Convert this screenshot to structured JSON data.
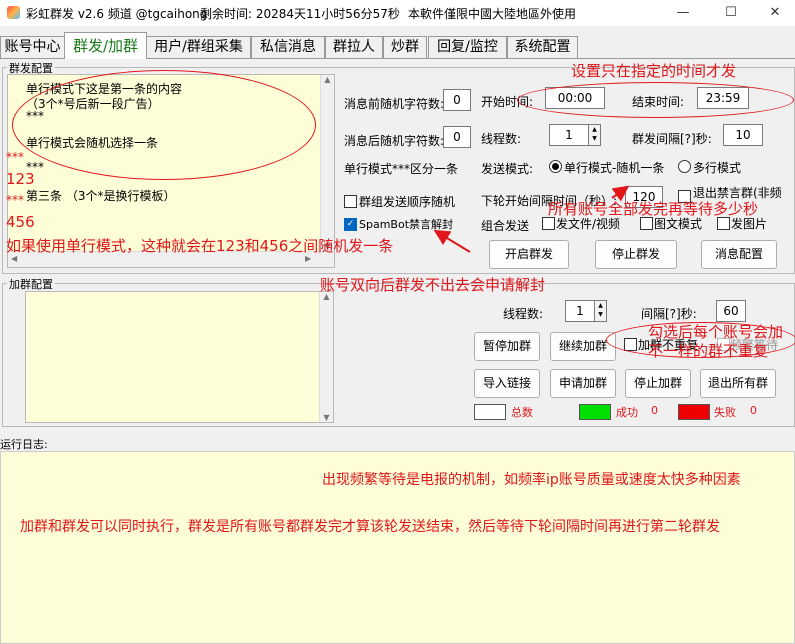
{
  "titlebar": {
    "app_name": "彩虹群发 v2.6 频道 @tgcaihong",
    "remaining": "剩余时间: 20284天11小时56分57秒",
    "notice": "本軟件僅限中國大陸地區外使用",
    "min_label": "—",
    "max_label": "☐",
    "close_label": "✕"
  },
  "tabs": [
    "账号中心",
    "群发/加群",
    "用户/群组采集",
    "私信消息",
    "群拉人",
    "炒群",
    "回复/监控",
    "系统配置"
  ],
  "broadcast": {
    "group_label": "群发配置",
    "message_lines": [
      "单行模式下这是第一条的内容",
      "（3个*号后新一段广告）",
      "***",
      "单行模式会随机选择一条",
      "***",
      "第三条 （3个*是换行模板）"
    ],
    "prefix_rand_label": "消息前随机字符数:",
    "prefix_rand_value": "0",
    "start_time_label": "开始时间:",
    "start_time_value": "00:00",
    "end_time_label": "结束时间:",
    "end_time_value": "23:59",
    "suffix_rand_label": "消息后随机字符数:",
    "suffix_rand_value": "0",
    "threads_label": "线程数:",
    "threads_value": "1",
    "interval_label": "群发间隔[?]秒:",
    "interval_value": "10",
    "single_mode_label": "单行模式***区分一条",
    "send_mode_label": "发送模式:",
    "radio_single_label": "单行模式-随机一条",
    "radio_multi_label": "多行模式",
    "group_random_label": "群组发送顺序随机",
    "next_round_label": "下轮开始间隔时间（秒）:",
    "next_round_value": "120",
    "leave_banned_label": "退出禁言群(非频",
    "spambot_label": "SpamBot禁言解封",
    "combo_send_label": "组合发送",
    "send_file_label": "发文件/视频",
    "image_mode_label": "图文模式",
    "send_image_label": "发图片",
    "start_btn": "开启群发",
    "stop_btn": "停止群发",
    "msg_config_btn": "消息配置"
  },
  "join": {
    "group_label": "加群配置",
    "threads_label": "线程数:",
    "threads_value": "1",
    "interval_label": "间隔[?]秒:",
    "interval_value": "60",
    "pause_btn": "暂停加群",
    "resume_btn": "继续加群",
    "no_repeat_label": "加群不重复",
    "frequent_wait_label": "频繁等待",
    "import_btn": "导入链接",
    "apply_btn": "申请加群",
    "stop_btn": "停止加群",
    "leave_all_btn": "退出所有群",
    "stats": [
      {
        "label": "总数",
        "value": "",
        "color": "#ffffff"
      },
      {
        "label": "成功",
        "value": "0",
        "color": "#00e000"
      },
      {
        "label": "失败",
        "value": "0",
        "color": "#ee0000"
      }
    ]
  },
  "log": {
    "label": "运行日志:"
  },
  "annotations": {
    "time_note": "设置只在指定的时间才发",
    "wait_note": "所有账号全部发完再等待多少秒",
    "stars_note": "***",
    "n123": "123",
    "stars_note2": "***",
    "n456": "456",
    "single_mode_note": "如果使用单行模式，这种就会在123和456之间随机发一条",
    "spambot_note": "账号双向后群发不出去会申请解封",
    "no_repeat_note_1": "勾选后每个账号会加",
    "no_repeat_note_2": "不一样的群不重复",
    "freq_note": "出现频繁等待是电报的机制，如频率ip账号质量或速度太快多种因素",
    "parallel_note": "加群和群发可以同时执行，群发是所有账号都群发完才算该轮发送结束，然后等待下轮间隔时间再进行第二轮群发"
  },
  "colors": {
    "annotation": "#e0161b",
    "active_tab": "#1a7a1a",
    "text_pane": "#fdfdd8"
  }
}
